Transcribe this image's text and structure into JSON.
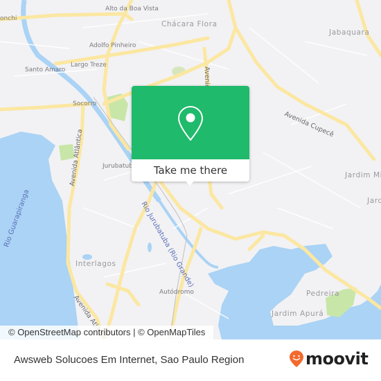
{
  "map": {
    "labels": {
      "alto_da_boa_vista": "Alto da Boa Vista",
      "chacara_flora": "Chácara Flora",
      "jabaquara": "Jabaquara",
      "conchi": "onchi",
      "adolfo_pinheiro": "Adolfo Pinheiro",
      "santo_amaro": "Santo Amaro",
      "largo_treze": "Largo Treze",
      "socorro": "Socorro",
      "avenida_cupece": "Avenida Cupecê",
      "avenida_atlantica_north": "Avenida Atlântica",
      "avenida_atlantica_south": "Avenida Atlântica",
      "avenida_top": "Avenida",
      "jurubatuba": "Jurubatuba",
      "jardim_mi": "Jardim Mi",
      "jard": "Jard",
      "rio_guarapiranga": "Rio Guarapiranga",
      "rio_jurubatuba": "Rio Jurubatuba (Rio Grande)",
      "interlagos": "Interlagos",
      "autodromo": "Autódromo",
      "pedreira": "Pedreira",
      "jardim_apura": "Jardim Apurá"
    },
    "colors": {
      "land": "#f2f2f4",
      "water": "#aad3f5",
      "park": "#c8e6a8",
      "major_road": "#fbe7a1",
      "minor_road": "#ffffff"
    }
  },
  "popup": {
    "button_label": "Take me there",
    "icon": "map-pin-icon",
    "color": "#1fba6b"
  },
  "attribution": "© OpenStreetMap contributors | © OpenMapTiles",
  "footer": {
    "title": "Awsweb Solucoes Em Internet, Sao Paulo Region",
    "brand": "moovit",
    "brand_color": "#f26a2e"
  }
}
